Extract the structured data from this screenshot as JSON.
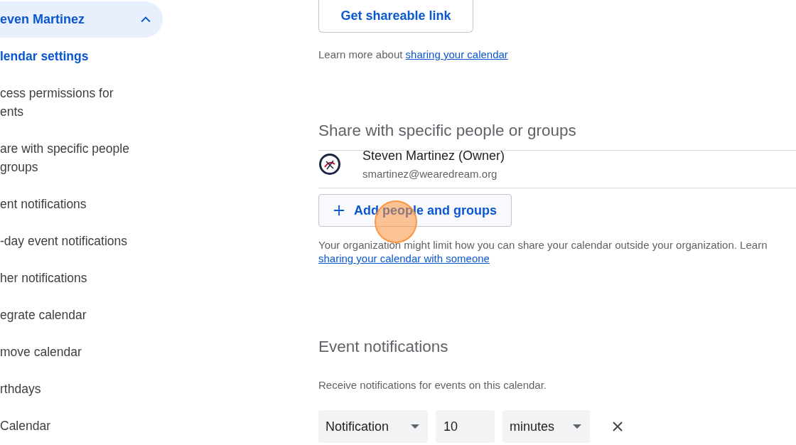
{
  "sidebar": {
    "calendar": {
      "name": "even Martinez",
      "expanded": true
    },
    "items": [
      {
        "label": "lendar settings",
        "selected": true
      },
      {
        "label": "cess permissions for\nents",
        "selected": false
      },
      {
        "label": "are with specific people\ngroups",
        "selected": false
      },
      {
        "label": "ent notifications",
        "selected": false
      },
      {
        "label": "-day event notifications",
        "selected": false
      },
      {
        "label": "her notifications",
        "selected": false
      },
      {
        "label": "egrate calendar",
        "selected": false
      },
      {
        "label": "move calendar",
        "selected": false
      },
      {
        "label": "rthdays",
        "selected": false
      },
      {
        "label": "Calendar",
        "selected": false
      }
    ]
  },
  "link_section": {
    "button": "Get shareable link",
    "learn_more": {
      "text": "Learn more about",
      "link": "sharing your calendar"
    }
  },
  "share_section": {
    "title": "Share with specific people or groups",
    "people": [
      {
        "name": "Steven Martinez (Owner)",
        "email": "smartinez@wearedream.org"
      }
    ],
    "add_button": "Add people and groups",
    "note": {
      "text": "Your organization might limit how you can share your calendar outside your organization. Learn",
      "link": "sharing your calendar with someone"
    }
  },
  "notifications": {
    "title": "Event notifications",
    "description": "Receive notifications for events on this calendar.",
    "rows": [
      {
        "type": "Notification",
        "amount": "10",
        "unit": "minutes"
      }
    ]
  }
}
